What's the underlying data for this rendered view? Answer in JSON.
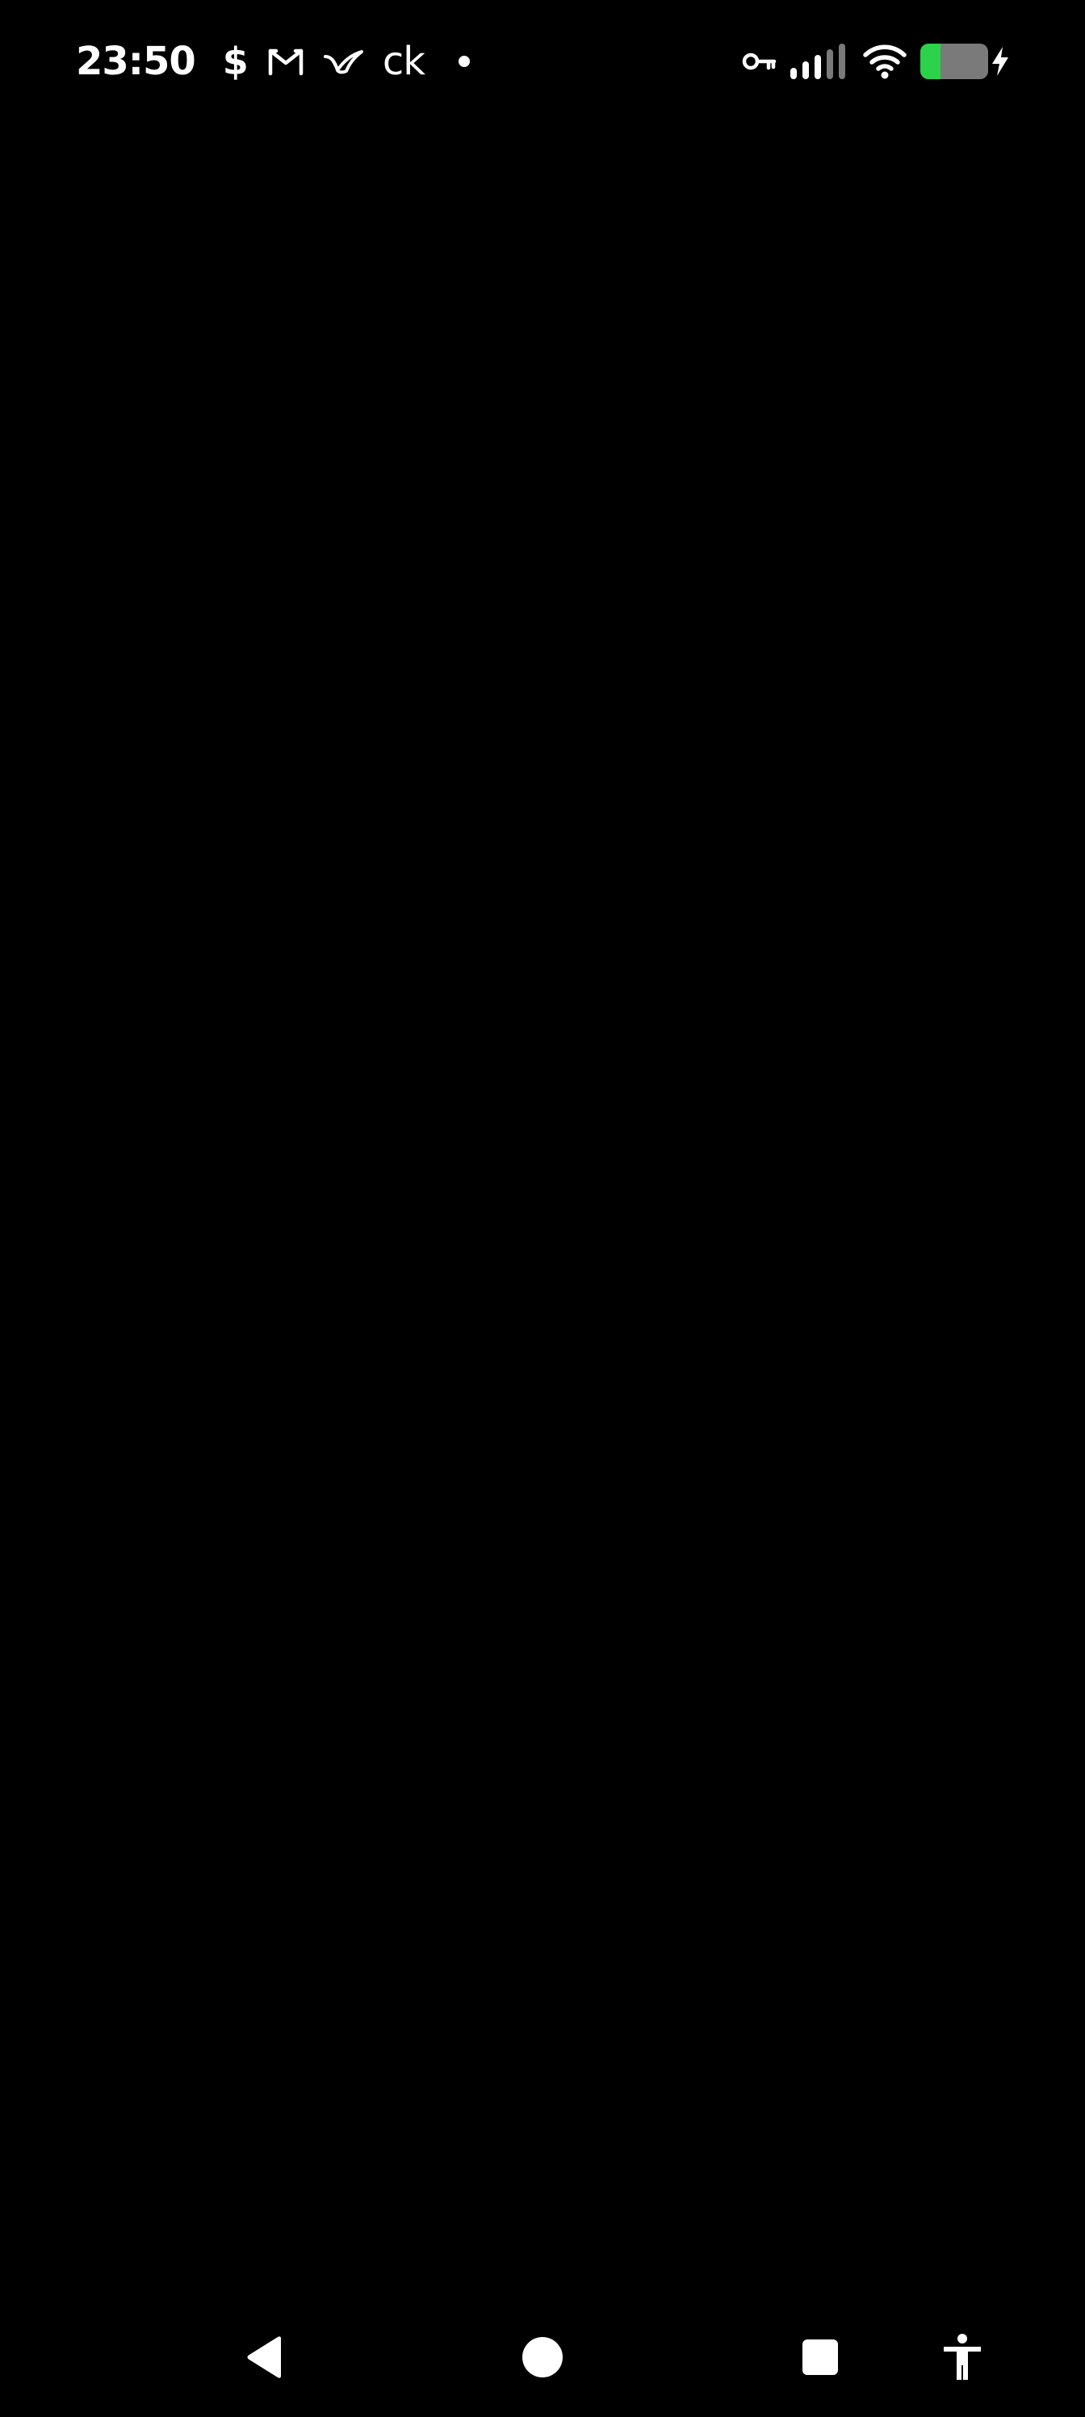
{
  "status_bar": {
    "time": "23:50",
    "notifications": [
      {
        "icon": "dollar-icon",
        "glyph": "$"
      },
      {
        "icon": "gmail-icon"
      },
      {
        "icon": "bird-icon"
      },
      {
        "icon": "ck-icon",
        "glyph": "ck"
      },
      {
        "icon": "more-notifications-dot"
      }
    ],
    "system_icons": [
      "vpn-key-icon",
      "cellular-signal-icon",
      "wifi-icon",
      "battery-charging-icon"
    ],
    "battery_level": 0.3,
    "battery_fill_color": "#2bd24a"
  },
  "screen": {
    "background": "#000000"
  },
  "navigation_bar": {
    "buttons": [
      "back-button",
      "home-button",
      "recents-button",
      "accessibility-button"
    ]
  }
}
